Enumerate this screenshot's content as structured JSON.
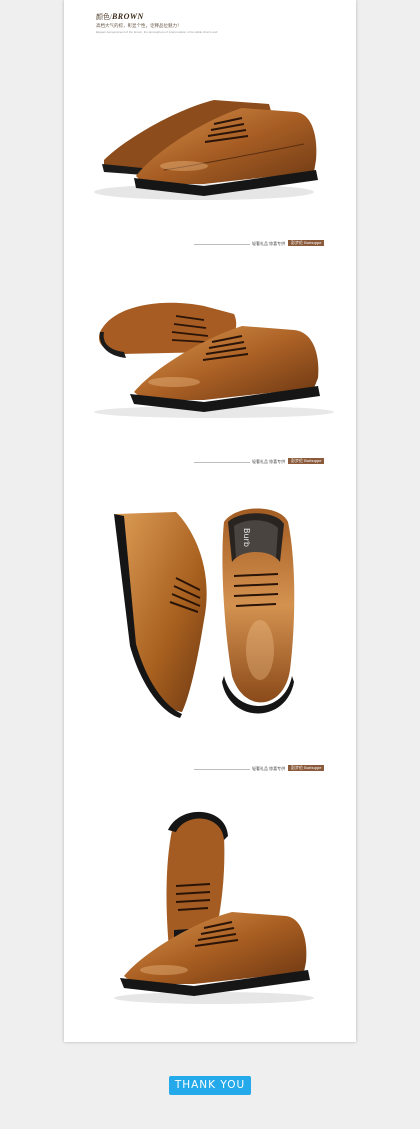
{
  "color_header": {
    "label_cn": "颜色/",
    "label_en": "BROWN",
    "subtitle": "高档大气的棕，彰显个性，诠释品位魅力！",
    "fine_print": "Elegant temperament of the brown, the atmosphere of interpretation of its subtle charm and"
  },
  "brand_rows": [
    {
      "text": "轻奢礼品 惊喜专供",
      "tag": "彭步伦 Burbuppe"
    },
    {
      "text": "轻奢礼品 惊喜专供",
      "tag": "彭步伦 Burbuppe"
    },
    {
      "text": "轻奢礼品 惊喜专供",
      "tag": "彭步伦 Burbuppe"
    }
  ],
  "insole_text": "Burb",
  "thank_you": "THANK YOU",
  "colors": {
    "accent": "#24a9ea",
    "tag": "#8a5a3a",
    "leather": "#b06a2c",
    "sole": "#1a1a1a"
  }
}
